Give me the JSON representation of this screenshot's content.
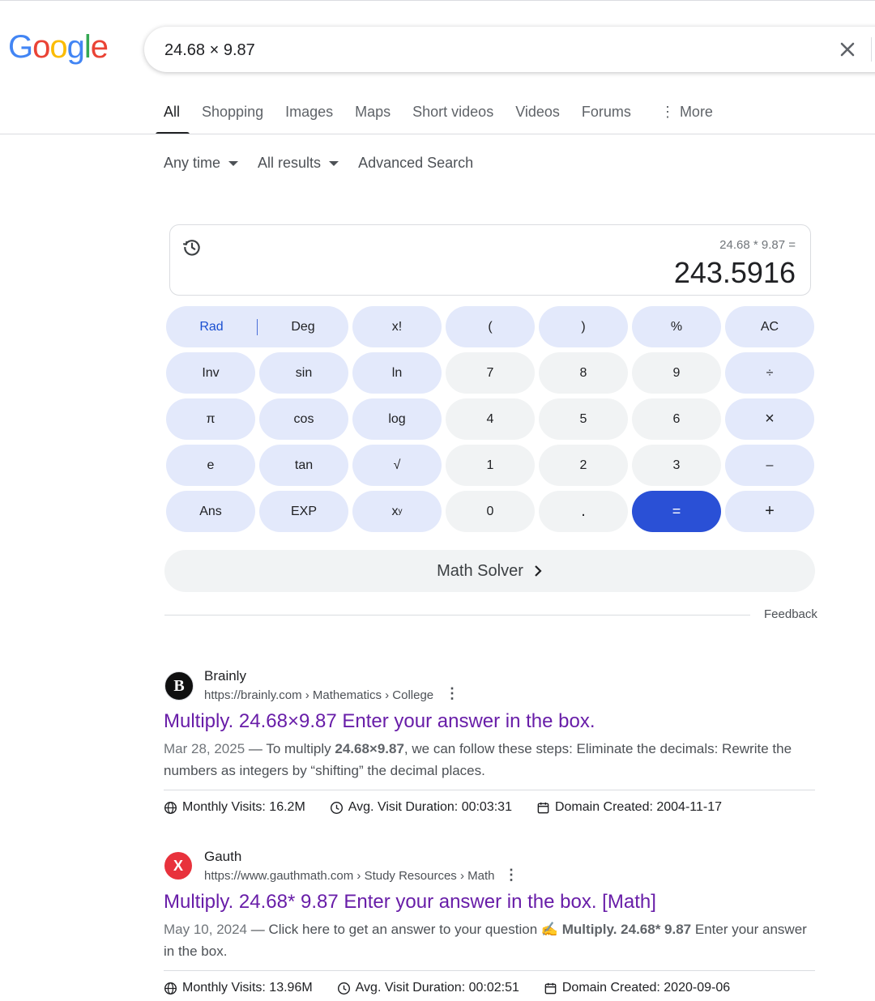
{
  "logo": {
    "letters": [
      "G",
      "o",
      "o",
      "g",
      "l",
      "e"
    ],
    "colors": [
      "#4285F4",
      "#EA4335",
      "#FBBC05",
      "#4285F4",
      "#34A853",
      "#EA4335"
    ]
  },
  "search": {
    "query": "24.68 × 9.87",
    "clear_icon": "close-icon"
  },
  "tabs": [
    "All",
    "Shopping",
    "Images",
    "Maps",
    "Short videos",
    "Videos",
    "Forums",
    "More"
  ],
  "filters": {
    "time": "Any time",
    "results": "All results",
    "advanced": "Advanced Search"
  },
  "calculator": {
    "expression": "24.68 * 9.87 =",
    "result": "243.5916",
    "rad": "Rad",
    "deg": "Deg",
    "keys": {
      "fact": "x!",
      "lparen": "(",
      "rparen": ")",
      "percent": "%",
      "ac": "AC",
      "inv": "Inv",
      "sin": "sin",
      "ln": "ln",
      "seven": "7",
      "eight": "8",
      "nine": "9",
      "divide": "÷",
      "pi": "π",
      "cos": "cos",
      "log": "log",
      "four": "4",
      "five": "5",
      "six": "6",
      "multiply": "×",
      "e": "e",
      "tan": "tan",
      "sqrt": "√",
      "one": "1",
      "two": "2",
      "three": "3",
      "minus": "–",
      "ans": "Ans",
      "exp": "EXP",
      "pow_base": "x",
      "pow_exp": "y",
      "zero": "0",
      "dot": ".",
      "equals": "=",
      "plus": "+"
    },
    "math_solver": "Math Solver",
    "feedback": "Feedback",
    "accent": "#2a50d6"
  },
  "results": [
    {
      "site": "Brainly",
      "favicon_letter": "B",
      "url": "https://brainly.com › Mathematics › College",
      "title": "Multiply. 24.68×9.87 Enter your answer in the box.",
      "date": "Mar 28, 2025",
      "dash": " — ",
      "snippet_a": "To multiply ",
      "snippet_bold": "24.68×9.87",
      "snippet_b": ", we can follow these steps: Eliminate the decimals: Rewrite the numbers as integers by “shifting” the decimal places.",
      "visits": "Monthly Visits: 16.2M",
      "duration": "Avg. Visit Duration: 00:03:31",
      "created": "Domain Created: 2004-11-17"
    },
    {
      "site": "Gauth",
      "favicon_letter": "X",
      "url": "https://www.gauthmath.com › Study Resources › Math",
      "title": "Multiply. 24.68* 9.87 Enter your answer in the box. [Math]",
      "date": "May 10, 2024",
      "dash": " — ",
      "snippet_a": "Click here to get an answer to your question ✍️ ",
      "snippet_bold": "Multiply. 24.68* 9.87",
      "snippet_b": " Enter your answer in the box.",
      "visits": "Monthly Visits: 13.96M",
      "duration": "Avg. Visit Duration: 00:02:51",
      "created": "Domain Created: 2020-09-06"
    }
  ]
}
